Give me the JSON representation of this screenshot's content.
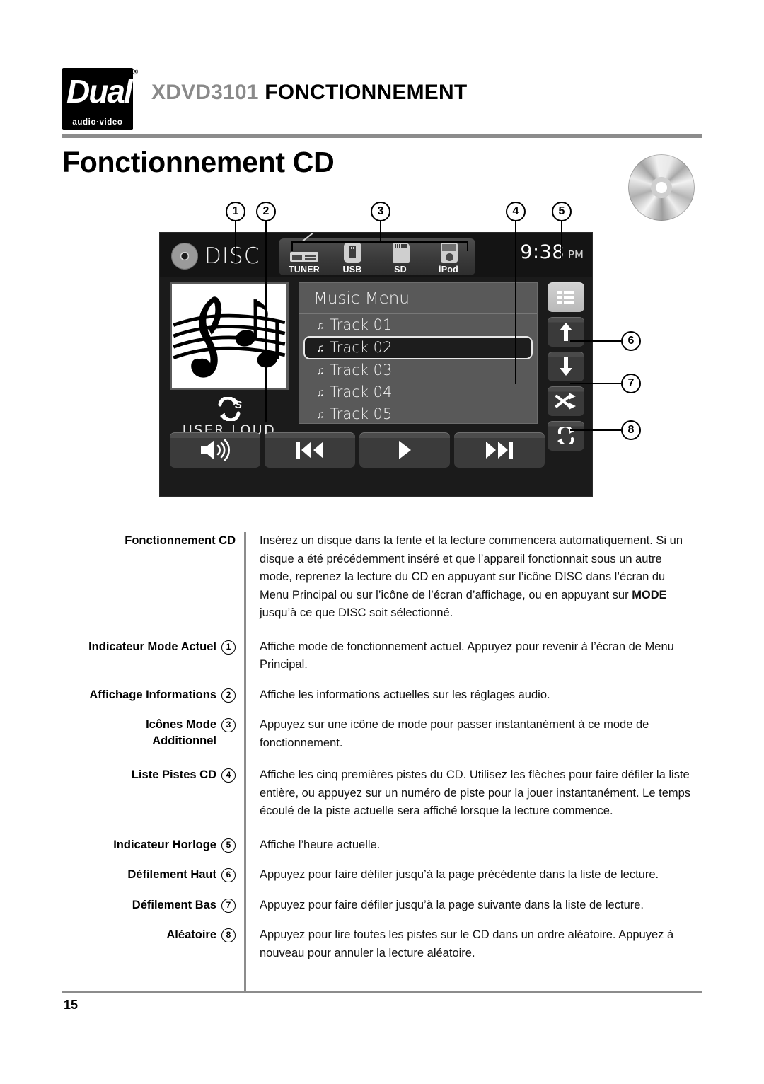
{
  "header": {
    "logo_word": "Dual",
    "logo_registered": "®",
    "logo_subtitle": "audio·video",
    "model": "XDVD3101",
    "section": "FONCTIONNEMENT",
    "page_title": "Fonctionnement CD"
  },
  "device": {
    "mode_indicator": "DISC",
    "mode_icons": [
      {
        "label": "TUNER",
        "icon": "radio-icon"
      },
      {
        "label": "USB",
        "icon": "usb-drive-icon"
      },
      {
        "label": "SD",
        "icon": "sd-card-icon"
      },
      {
        "label": "iPod",
        "icon": "ipod-icon"
      }
    ],
    "clock": {
      "time": "9:38",
      "ampm": "PM"
    },
    "audio_info": {
      "repeat_icon": "repeat-single-icon",
      "text": "USER  LOUD"
    },
    "album_art_icon": "music-staff-notes-icon",
    "track_menu": {
      "title": "Music Menu",
      "tracks": [
        {
          "label": "Track 01",
          "selected": false
        },
        {
          "label": "Track 02",
          "selected": true
        },
        {
          "label": "Track 03",
          "selected": false
        },
        {
          "label": "Track 04",
          "selected": false
        },
        {
          "label": "Track 05",
          "selected": false
        }
      ]
    },
    "side_buttons": [
      {
        "icon": "list-icon",
        "active": true
      },
      {
        "icon": "arrow-up-icon",
        "active": false
      },
      {
        "icon": "arrow-down-icon",
        "active": false
      },
      {
        "icon": "shuffle-icon",
        "active": false
      },
      {
        "icon": "repeat-icon",
        "active": false
      }
    ],
    "transport_buttons": [
      {
        "icon": "volume-speaker-icon"
      },
      {
        "icon": "previous-track-icon"
      },
      {
        "icon": "play-icon"
      },
      {
        "icon": "next-track-icon"
      }
    ]
  },
  "callouts": [
    "1",
    "2",
    "3",
    "4",
    "5",
    "6",
    "7",
    "8"
  ],
  "descriptions": [
    {
      "term": "Fonctionnement CD",
      "num": "",
      "text_before": "Insérez un disque dans la fente et la lecture commencera automatiquement. Si un disque a été précédemment inséré et que l’appareil fonctionnait sous un autre mode, reprenez la lecture du CD en appuyant sur l’icône DISC dans l’écran du Menu Principal ou sur l’icône de l’écran d’affichage, ou en appuyant sur ",
      "bold": "MODE",
      "text_after": " jusqu’à ce que DISC soit sélectionné."
    },
    {
      "term": "Indicateur Mode Actuel",
      "num": "1",
      "text": "Affiche mode de fonctionnement actuel. Appuyez pour revenir à l’écran de Menu Principal."
    },
    {
      "term": "Affichage Informations",
      "num": "2",
      "text": "Affiche les informations actuelles sur les réglages audio."
    },
    {
      "term": "Icônes Mode Additionnel",
      "num": "3",
      "text": "Appuyez sur une icône de mode pour passer instantanément à ce mode de fonctionnement."
    },
    {
      "term": "Liste Pistes CD",
      "num": "4",
      "text": "Affiche les cinq premières pistes du CD. Utilisez les flèches pour faire défiler la liste entière, ou appuyez sur un numéro de piste pour la jouer instantanément. Le temps écoulé de la piste actuelle sera affiché lorsque la lecture commence."
    },
    {
      "term": "Indicateur Horloge",
      "num": "5",
      "text": "Affiche l’heure actuelle."
    },
    {
      "term": "Défilement Haut",
      "num": "6",
      "text": "Appuyez pour faire défiler jusqu’à la page précédente dans la liste de lecture."
    },
    {
      "term": "Défilement Bas",
      "num": "7",
      "text": "Appuyez pour faire défiler jusqu’à la page suivante dans la liste de lecture."
    },
    {
      "term": "Aléatoire",
      "num": "8",
      "text": "Appuyez pour lire toutes les pistes sur le CD dans un ordre aléatoire. Appuyez à nouveau pour annuler la lecture aléatoire."
    }
  ],
  "footer": {
    "page_number": "15"
  }
}
